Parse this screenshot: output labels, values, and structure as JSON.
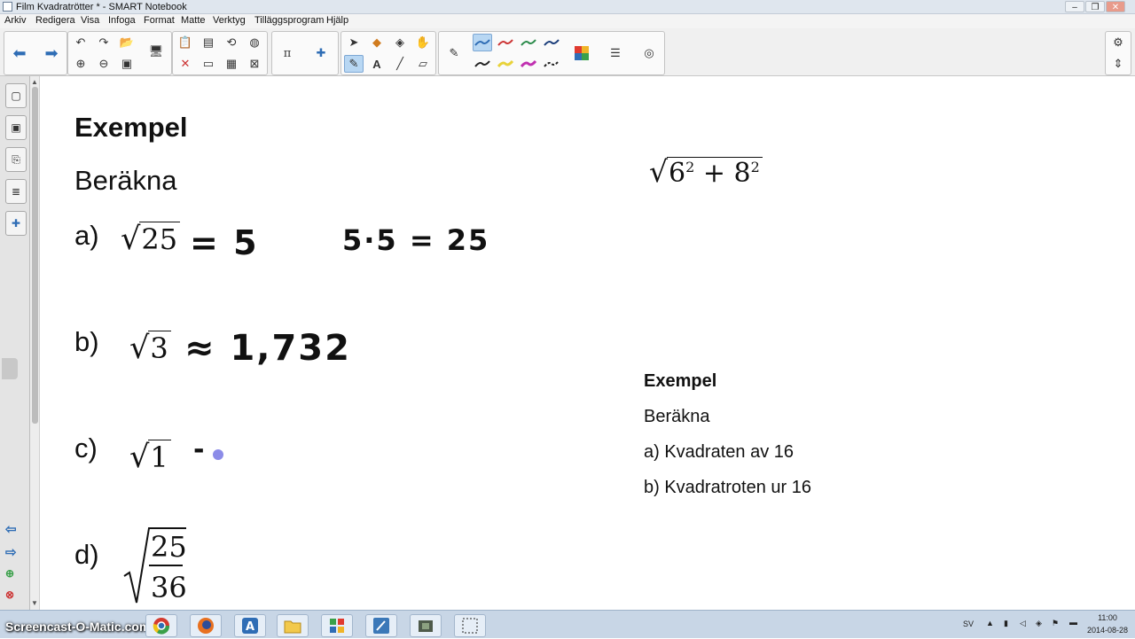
{
  "window": {
    "title": "Film Kvadratrötter * - SMART Notebook"
  },
  "menu": [
    "Arkiv",
    "Redigera",
    "Visa",
    "Infoga",
    "Format",
    "Matte",
    "Verktyg",
    "Tilläggsprogram",
    "Hjälp"
  ],
  "page": {
    "heading": "Exempel",
    "intro": "Beräkna",
    "a_label": "a)",
    "a_radicand": "25",
    "a_answer": "= 5",
    "a_check": "5·5 = 25",
    "b_label": "b)",
    "b_radicand": "3",
    "b_answer": "≈ 1,732",
    "c_label": "c)",
    "c_radicand": "1",
    "c_answer": "-",
    "d_label": "d)",
    "d_num": "25",
    "d_den": "36",
    "side_expr_base1": "6",
    "side_expr_exp1": "2",
    "side_expr_op": "+",
    "side_expr_base2": "8",
    "side_expr_exp2": "2",
    "note_heading": "Exempel",
    "note_intro": "Beräkna",
    "note_a": "a) Kvadraten av 16",
    "note_b": "b) Kvadratroten ur 16"
  },
  "taskbar": {
    "watermark": "Screencast-O-Matic.com",
    "lang": "SV",
    "time": "11:00",
    "date": "2014-08-28"
  }
}
